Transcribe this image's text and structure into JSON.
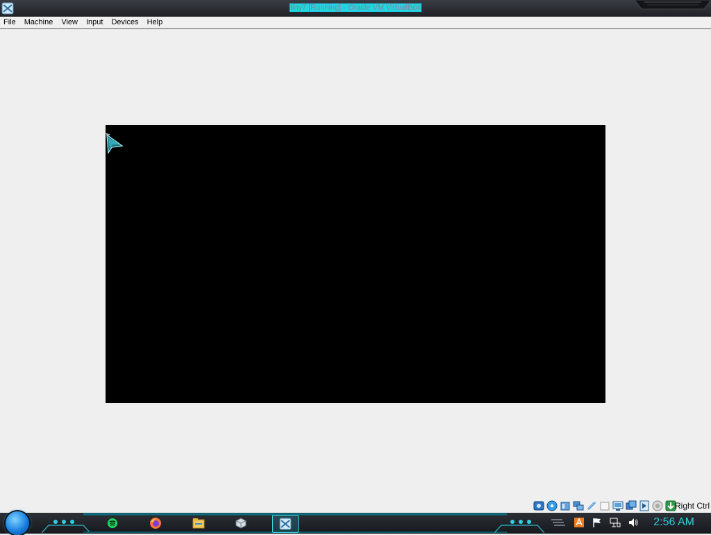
{
  "window": {
    "title": "tiny7 [Running] - Oracle VM VirtualBox",
    "app_icon": "virtualbox-icon"
  },
  "menu": {
    "items": [
      {
        "label": "File"
      },
      {
        "label": "Machine"
      },
      {
        "label": "View"
      },
      {
        "label": "Input"
      },
      {
        "label": "Devices"
      },
      {
        "label": "Help"
      }
    ]
  },
  "statusbar": {
    "icons": [
      "hard-disk-icon",
      "optical-drive-icon",
      "audio-icon",
      "network-icon",
      "usb-icon",
      "shared-folders-icon",
      "display-icon",
      "recording-icon",
      "mouse-integration-icon",
      "cpu-icon",
      "keyboard-capture-icon"
    ],
    "host_key": "Right Ctrl"
  },
  "taskbar": {
    "apps": [
      {
        "name": "spotify-icon",
        "active": false
      },
      {
        "name": "firefox-icon",
        "active": false
      },
      {
        "name": "file-explorer-icon",
        "active": false
      },
      {
        "name": "virtualbox-manager-icon",
        "active": false
      },
      {
        "name": "virtualbox-vm-icon",
        "active": true
      }
    ],
    "tray_icons": [
      "show-desktop-icon",
      "avast-icon",
      "action-center-flag-icon",
      "network-tray-icon",
      "volume-icon"
    ],
    "clock": "2:56 AM"
  },
  "colors": {
    "accent": "#2fd0de",
    "title_highlight": "#22d3e6",
    "vm_background": "#000000",
    "window_background": "#efefef"
  }
}
